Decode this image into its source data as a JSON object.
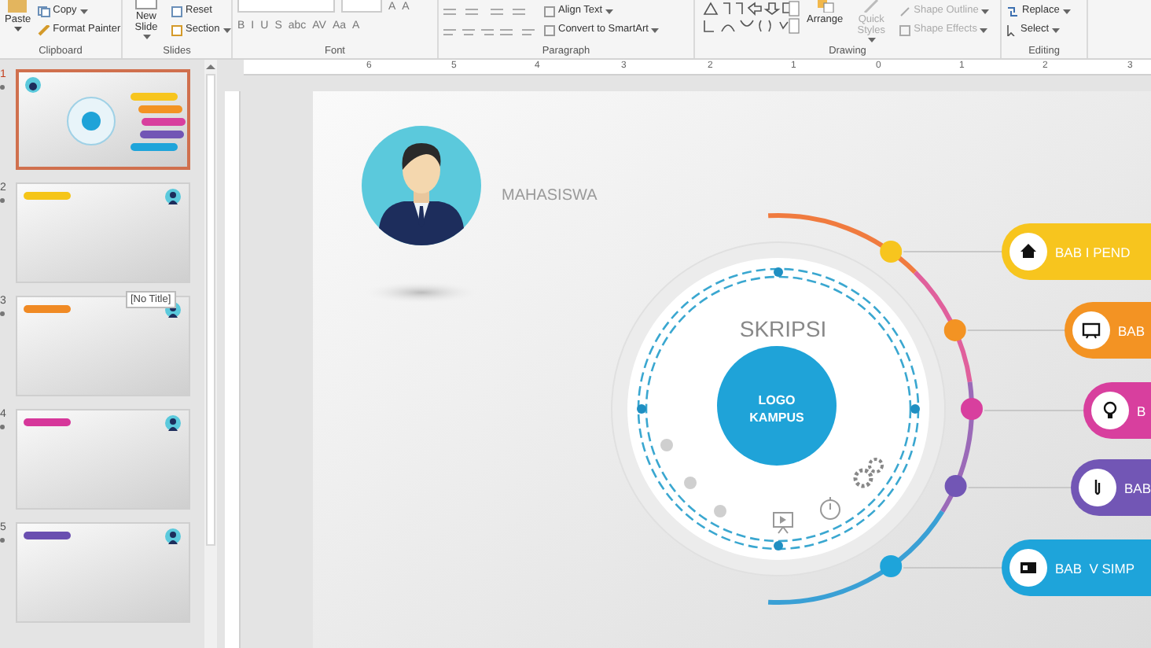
{
  "ribbon": {
    "groups": [
      {
        "label": "Clipboard",
        "items": [
          "Paste",
          "Copy",
          "Format Painter"
        ]
      },
      {
        "label": "Slides",
        "items": [
          "New Slide",
          "Reset",
          "Section"
        ]
      },
      {
        "label": "Font",
        "items": [
          "A",
          "A",
          "B",
          "I",
          "U",
          "S",
          "abc",
          "AV",
          "Aa",
          "A"
        ]
      },
      {
        "label": "Paragraph",
        "items": [
          "Align Text",
          "Convert to SmartArt"
        ]
      },
      {
        "label": "Drawing",
        "items": [
          "Arrange",
          "Quick Styles",
          "Shape Outline",
          "Shape Effects"
        ]
      },
      {
        "label": "Editing",
        "items": [
          "Replace",
          "Select"
        ]
      }
    ]
  },
  "ruler": {
    "labels": [
      "6",
      "5",
      "4",
      "3",
      "2",
      "1",
      "0",
      "1",
      "2",
      "3"
    ]
  },
  "thumbnails": [
    {
      "number": "1",
      "selected": true,
      "kind": "title"
    },
    {
      "number": "2",
      "selected": false,
      "kind": "content",
      "color": "#f5c518"
    },
    {
      "number": "3",
      "selected": false,
      "kind": "content",
      "color": "#f08a24"
    },
    {
      "number": "4",
      "selected": false,
      "kind": "content",
      "color": "#d6379a"
    },
    {
      "number": "5",
      "selected": false,
      "kind": "content",
      "color": "#6a4fb0"
    }
  ],
  "tooltip": "[No Title]",
  "slide": {
    "student": "MAHASISWA",
    "title": "SKRIPSI",
    "logo": [
      "LOGO",
      "KAMPUS"
    ],
    "chapters": [
      {
        "label": "BAB I PEND",
        "color": "#f7c51e"
      },
      {
        "label": "BAB",
        "color": "#f39323"
      },
      {
        "label": "B",
        "color": "#d83f9e"
      },
      {
        "label": "BAB",
        "color": "#7256b5"
      },
      {
        "label": "BAB  V SIMP",
        "color": "#1ea4da"
      }
    ]
  }
}
